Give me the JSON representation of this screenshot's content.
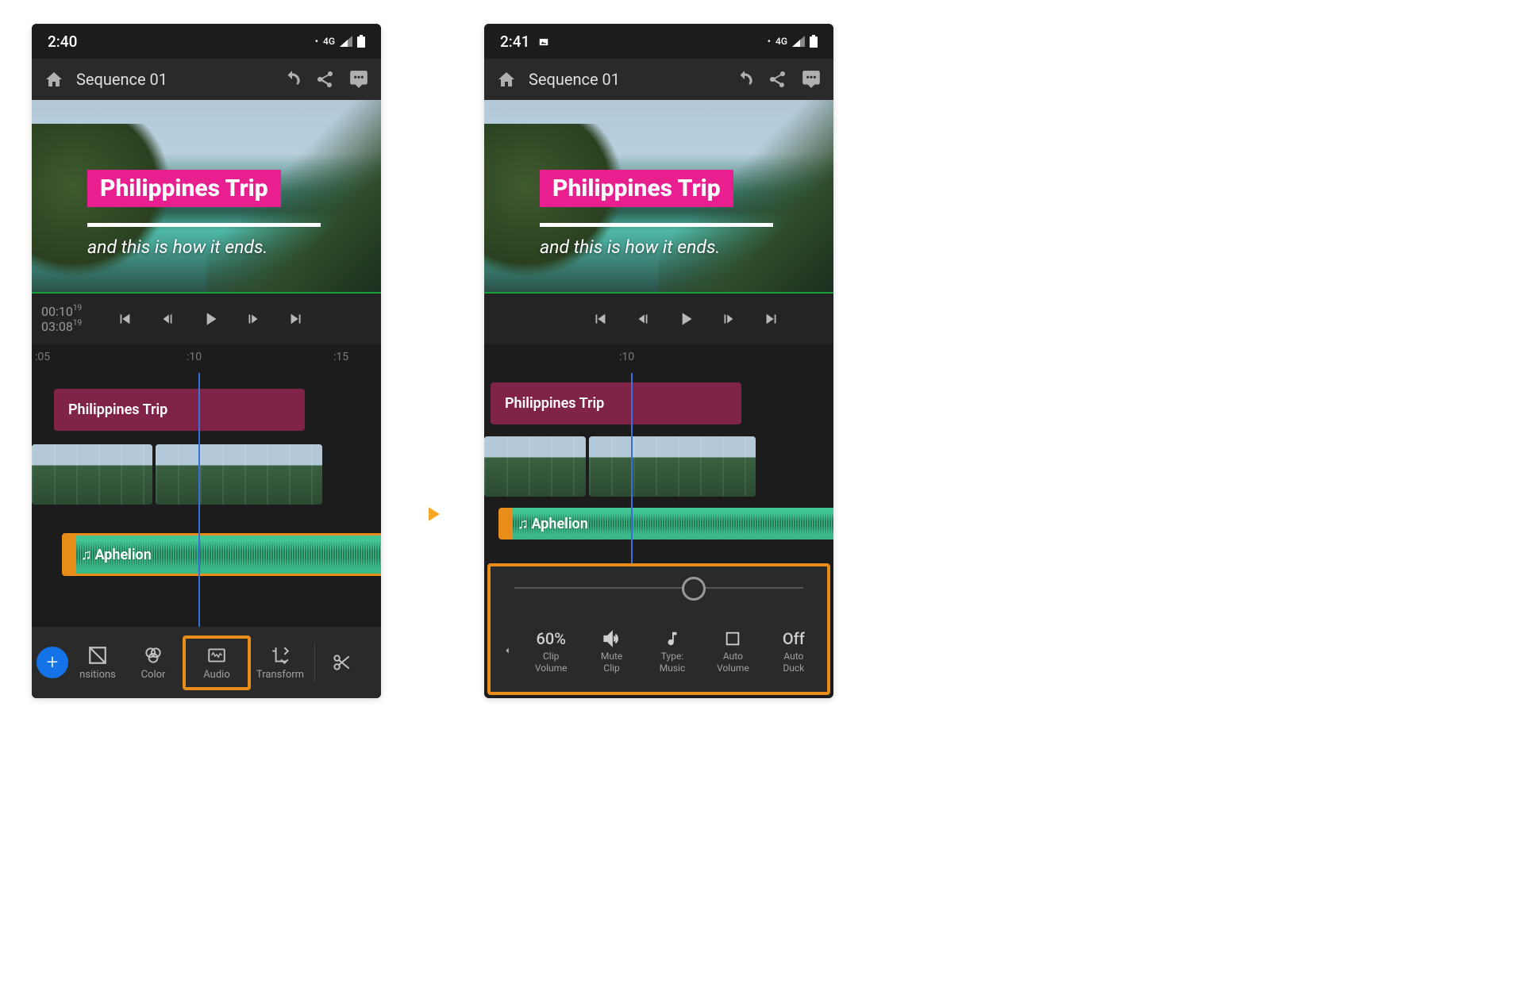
{
  "phone1": {
    "status": {
      "time": "2:40",
      "network": "4G"
    },
    "topbar": {
      "title": "Sequence 01"
    },
    "preview": {
      "title": "Philippines Trip",
      "subtitle": "and this is how it ends."
    },
    "timecode": {
      "current": "00:10",
      "current_frames": "19",
      "total": "03:08",
      "total_frames": "19"
    },
    "ruler": {
      "labels": [
        ":05",
        ":10",
        ":15"
      ]
    },
    "clips": {
      "text": "Philippines Trip",
      "audio": "Aphelion"
    },
    "tools": {
      "transitions": "nsitions",
      "color": "Color",
      "audio": "Audio",
      "transform": "Transform"
    }
  },
  "phone2": {
    "status": {
      "time": "2:41",
      "network": "4G"
    },
    "topbar": {
      "title": "Sequence 01"
    },
    "preview": {
      "title": "Philippines Trip",
      "subtitle": "and this is how it ends."
    },
    "ruler": {
      "labels": [
        ":10"
      ]
    },
    "clips": {
      "text": "Philippines Trip",
      "audio": "Aphelion"
    },
    "audio_panel": {
      "clip_volume": {
        "value": "60%",
        "label1": "Clip",
        "label2": "Volume"
      },
      "mute": {
        "label1": "Mute",
        "label2": "Clip"
      },
      "type": {
        "label1": "Type:",
        "label2": "Music"
      },
      "auto_volume": {
        "label1": "Auto",
        "label2": "Volume"
      },
      "auto_duck": {
        "value": "Off",
        "label1": "Auto",
        "label2": "Duck"
      }
    }
  }
}
